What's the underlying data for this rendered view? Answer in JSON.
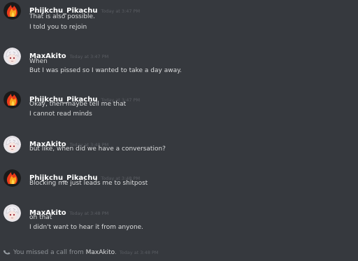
{
  "colors": {
    "background": "#36393e",
    "username": "#ffffff",
    "message_text": "#dcddde",
    "timestamp": "#5a5d63",
    "system_text": "#8e9297"
  },
  "messages": [
    {
      "author": "Phijkchu_Pikachu",
      "timestamp": "Today at 3:47 PM",
      "avatar": "pikachu-flame-avatar",
      "lines": [
        "That is also possible.",
        "I told you to rejoin"
      ]
    },
    {
      "author": "MaxAkito",
      "timestamp": "Today at 3:47 PM",
      "avatar": "maxakito-anime-avatar",
      "lines": [
        "When",
        "But I was pissed so I wanted to take a day away."
      ]
    },
    {
      "author": "Phijkchu_Pikachu",
      "timestamp": "Today at 3:47 PM",
      "avatar": "pikachu-flame-avatar",
      "lines": [
        "Okay, then maybe tell me that",
        "I cannot read minds"
      ]
    },
    {
      "author": "MaxAkito",
      "timestamp": "Today at 3:48 PM",
      "avatar": "maxakito-anime-avatar",
      "lines": [
        "but like, when did we have a conversation?"
      ]
    },
    {
      "author": "Phijkchu_Pikachu",
      "timestamp": "Today at 3:48 PM",
      "avatar": "pikachu-flame-avatar",
      "lines": [
        "Blocking me just leads me to shitpost"
      ]
    },
    {
      "author": "MaxAkito",
      "timestamp": "Today at 3:48 PM",
      "avatar": "maxakito-anime-avatar",
      "lines": [
        "oh that",
        "I didn't want to hear it from anyone."
      ]
    }
  ],
  "system_message": {
    "icon": "phone-icon",
    "text_prefix": "You missed a call from",
    "caller": "MaxAkito",
    "suffix": ".",
    "timestamp": "Today at 3:48 PM"
  }
}
